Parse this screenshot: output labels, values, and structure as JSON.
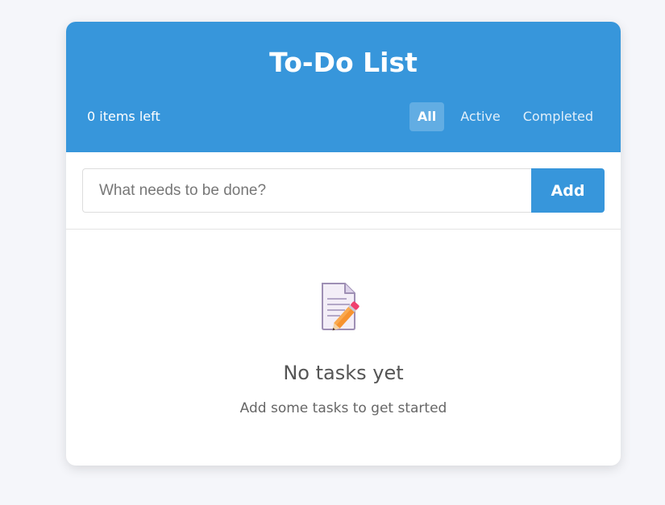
{
  "header": {
    "title": "To-Do List",
    "items_left": "0 items left",
    "filters": [
      {
        "label": "All",
        "active": true
      },
      {
        "label": "Active",
        "active": false
      },
      {
        "label": "Completed",
        "active": false
      }
    ]
  },
  "input": {
    "placeholder": "What needs to be done?",
    "value": "",
    "add_label": "Add"
  },
  "empty_state": {
    "icon": "memo-pencil-icon",
    "title": "No tasks yet",
    "subtitle": "Add some tasks to get started"
  },
  "colors": {
    "accent": "#3796db",
    "background": "#f5f6fa",
    "card": "#ffffff"
  }
}
